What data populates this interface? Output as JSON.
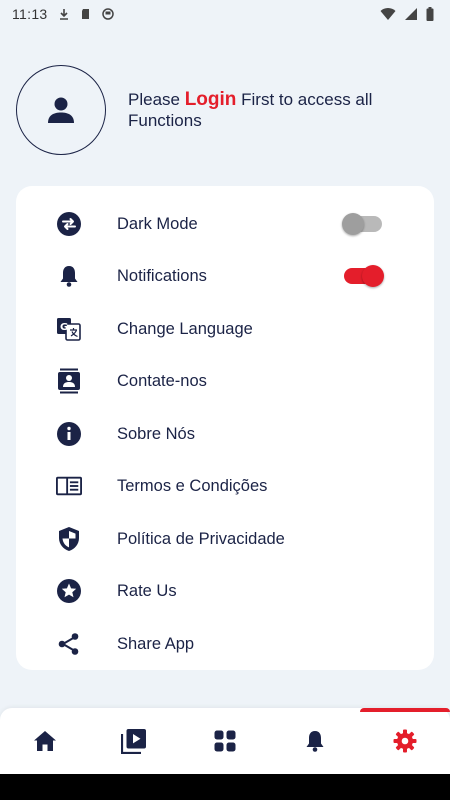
{
  "status_bar": {
    "time": "11:13"
  },
  "profile": {
    "prefix": "Please ",
    "login_link": "Login",
    "suffix": " First to access all Functions"
  },
  "settings": {
    "items": [
      {
        "label": "Dark Mode",
        "icon": "swap-icon",
        "toggle": false
      },
      {
        "label": "Notifications",
        "icon": "bell-icon",
        "toggle": true
      },
      {
        "label": "Change Language",
        "icon": "translate-icon"
      },
      {
        "label": "Contate-nos",
        "icon": "contact-icon"
      },
      {
        "label": "Sobre Nós",
        "icon": "info-icon"
      },
      {
        "label": "Termos e Condições",
        "icon": "document-icon"
      },
      {
        "label": "Política de Privacidade",
        "icon": "shield-icon"
      },
      {
        "label": "Rate Us",
        "icon": "star-icon"
      },
      {
        "label": "Share App",
        "icon": "share-icon"
      }
    ]
  },
  "bottom_nav": {
    "items": [
      {
        "icon": "home-icon",
        "active": false
      },
      {
        "icon": "video-library-icon",
        "active": false
      },
      {
        "icon": "grid-icon",
        "active": false
      },
      {
        "icon": "bell-icon",
        "active": false
      },
      {
        "icon": "settings-icon",
        "active": true
      }
    ]
  },
  "colors": {
    "accent": "#e41e2b",
    "navy": "#1b2346",
    "background": "#eef3f8",
    "card": "#ffffff"
  }
}
